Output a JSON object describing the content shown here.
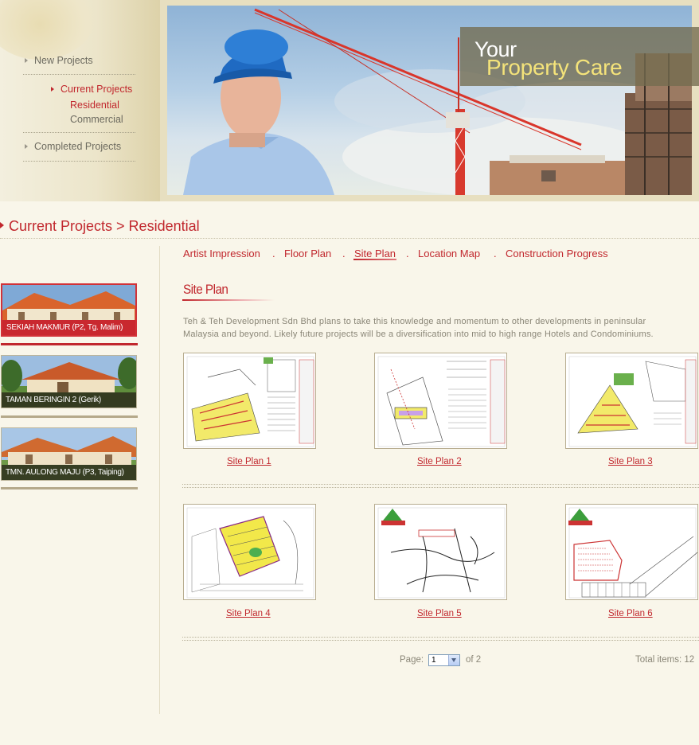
{
  "menu": {
    "items": [
      {
        "label": "New Projects"
      },
      {
        "label": "Current Projects"
      },
      {
        "label": "Residential"
      },
      {
        "label": "Commercial"
      },
      {
        "label": "Completed Projects"
      }
    ]
  },
  "hero": {
    "tagline_line1": "Your",
    "tagline_line2": "Property Care"
  },
  "breadcrumb": "Current Projects > Residential",
  "projects": [
    {
      "caption": "SEKIAH MAKMUR (P2, Tg. Malim)"
    },
    {
      "caption": "TAMAN BERINGIN 2 (Gerik)"
    },
    {
      "caption": "TMN. AULONG MAJU (P3, Taiping)"
    }
  ],
  "tabs": [
    {
      "label": "Artist Impression"
    },
    {
      "label": "Floor Plan"
    },
    {
      "label": "Site Plan"
    },
    {
      "label": "Location Map"
    },
    {
      "label": "Construction Progress"
    }
  ],
  "tab_separator": ".",
  "section": {
    "title": "Site Plan",
    "intro_line1": "Teh & Teh Development Sdn Bhd plans to take this knowledge and momentum to other developments in peninsular",
    "intro_line2": "Malaysia and beyond. Likely future projects will be a diversification into mid to high range Hotels and Condominiums."
  },
  "site_plans": [
    {
      "label": "Site Plan 1"
    },
    {
      "label": "Site Plan 2"
    },
    {
      "label": "Site Plan 3"
    },
    {
      "label": "Site Plan 4"
    },
    {
      "label": "Site Plan 5"
    },
    {
      "label": "Site Plan 6"
    }
  ],
  "pagination": {
    "page_label": "Page:",
    "current_page": "1",
    "of_label": "of  2",
    "total_items": "Total items: 12"
  },
  "colors": {
    "accent": "#c1272d",
    "background": "#f9f6ea",
    "muted_text": "#8a8677"
  }
}
